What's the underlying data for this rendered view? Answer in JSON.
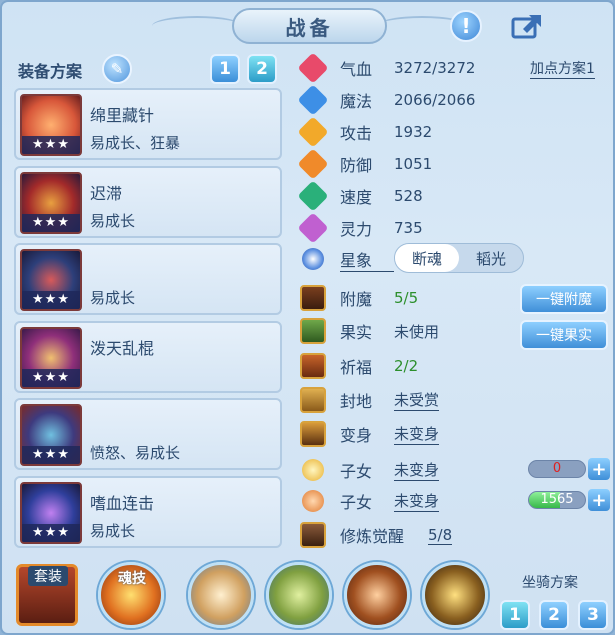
{
  "window": {
    "title": "战备"
  },
  "left": {
    "plan_label": "装备方案",
    "plan_buttons": [
      "1",
      "2"
    ],
    "equips": [
      {
        "name": "绵里藏针",
        "trait": "易成长、狂暴",
        "stars": "★★★",
        "color": "#d8573a"
      },
      {
        "name": "迟滞",
        "trait": "易成长",
        "stars": "★★★",
        "color": "#a32a2a"
      },
      {
        "name": "",
        "trait": "易成长",
        "stars": "★★★",
        "color": "#2d3f7a"
      },
      {
        "name": "泼天乱棍",
        "trait": "",
        "stars": "★★★",
        "color": "#8f2f7a"
      },
      {
        "name": "",
        "trait": "愤怒、易成长",
        "stars": "★★★",
        "color": "#3e3a7e"
      },
      {
        "name": "嗜血连击",
        "trait": "易成长",
        "stars": "★★★",
        "color": "#2f3f9c"
      }
    ]
  },
  "stats": {
    "add_plan": "加点方案1",
    "rows": [
      {
        "label": "气血",
        "value": "3272/3272",
        "icon": "heart-icon",
        "color": "#e84a6a"
      },
      {
        "label": "魔法",
        "value": "2066/2066",
        "icon": "mana-icon",
        "color": "#3d8fe6"
      },
      {
        "label": "攻击",
        "value": "1932",
        "icon": "attack-icon",
        "color": "#f2a92a"
      },
      {
        "label": "防御",
        "value": "1051",
        "icon": "defense-icon",
        "color": "#f08a2a"
      },
      {
        "label": "速度",
        "value": "528",
        "icon": "speed-icon",
        "color": "#2ab07a"
      },
      {
        "label": "灵力",
        "value": "735",
        "icon": "spirit-icon",
        "color": "#c060d0"
      }
    ],
    "star_label": "星象",
    "star_options": [
      "断魂",
      "韬光"
    ]
  },
  "extras": {
    "enchant": {
      "label": "附魔",
      "value": "5/5",
      "button": "一键附魔"
    },
    "fruit": {
      "label": "果实",
      "value": "未使用",
      "button": "一键果实"
    },
    "bless": {
      "label": "祈福",
      "value": "2/2"
    },
    "fief": {
      "label": "封地",
      "value": "未受赏"
    },
    "transform": {
      "label": "变身",
      "value": "未变身"
    },
    "child1": {
      "label": "子女",
      "value": "未变身",
      "bar": "0",
      "fill": 0.0
    },
    "child2": {
      "label": "子女",
      "value": "未变身",
      "bar": "1565",
      "fill": 0.55
    },
    "awaken": {
      "label": "修炼觉醒",
      "value": "5/8"
    }
  },
  "bottom": {
    "suit_label": "套装",
    "soul_label": "魂技",
    "mount_label": "坐骑方案",
    "mount_buttons": [
      "1",
      "2",
      "3"
    ]
  }
}
